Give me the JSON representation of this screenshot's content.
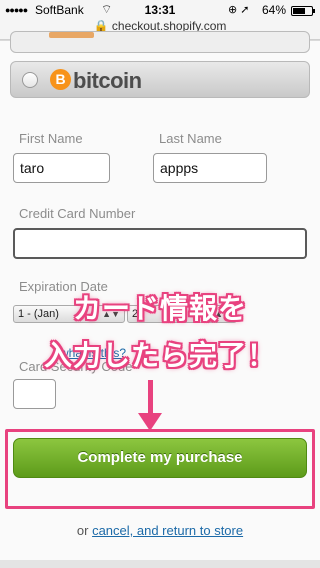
{
  "status_bar": {
    "signal": "●●●●●",
    "carrier": "SoftBank",
    "time": "13:31",
    "battery": "64%",
    "battery_level": 0.64
  },
  "browser": {
    "url": "checkout.shopify.com"
  },
  "payment": {
    "bitcoin_label": "bitcoin",
    "bitcoin_symbol": "B"
  },
  "form": {
    "first_name_label": "First Name",
    "first_name_value": "taro",
    "last_name_label": "Last Name",
    "last_name_value": "appps",
    "card_number_label": "Credit Card Number",
    "card_number_value": "",
    "expiration_label": "Expiration Date",
    "exp_month_value": "1 - (Jan)",
    "exp_year_value": "2",
    "security_label": "Card Security Code",
    "security_value": "",
    "what_is_this": "what is this?"
  },
  "annotation": {
    "line1": "カード情報を",
    "line2": "入力したら完了！",
    "highlight_color": "#e8427f"
  },
  "actions": {
    "complete_label": "Complete my purchase",
    "or_text": "or ",
    "cancel_link": "cancel, and return to store"
  }
}
